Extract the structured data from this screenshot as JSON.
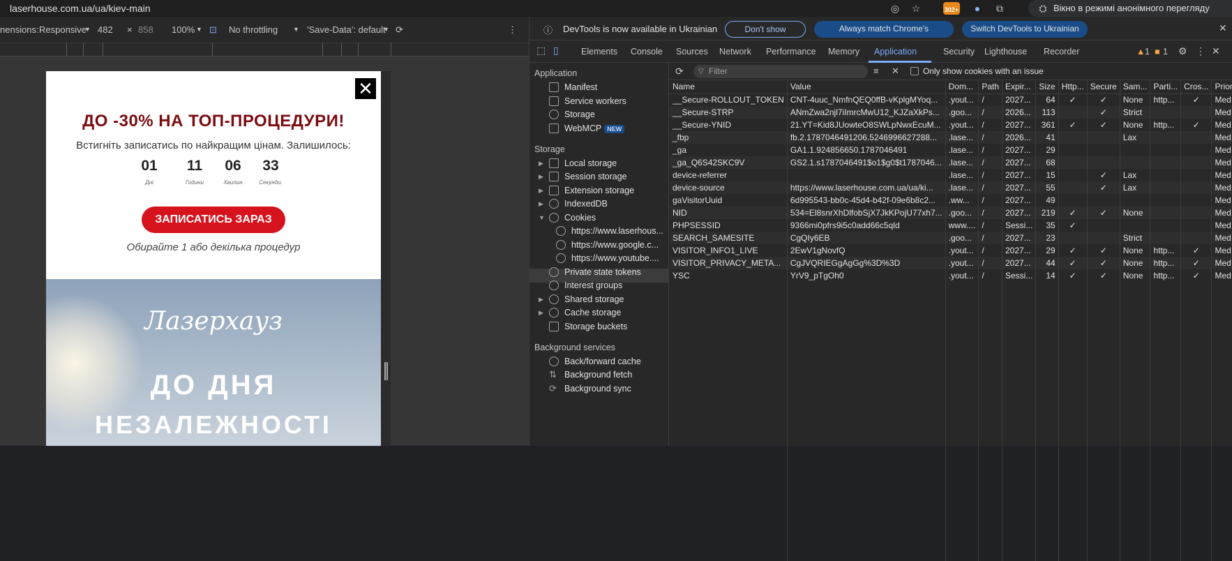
{
  "browser": {
    "url": "laserhouse.com.ua/ua/kiev-main",
    "extension_badge": "302+",
    "incognito_label": "Вікно в режимі анонімного перегляду"
  },
  "device_toolbar": {
    "dimensions_label": "nensions:",
    "mode": "Responsive",
    "width": "482",
    "times": "×",
    "height": "858",
    "zoom": "100%",
    "throttling": "No throttling",
    "save_data": "'Save-Data': default"
  },
  "popup": {
    "close_glyph": "✕",
    "headline": "ДО -30% НА ТОП-ПРОЦЕДУРИ!",
    "subtitle": "Встигніть записатись по найкращим цінам. Залишилось:",
    "countdown": [
      {
        "value": "01",
        "label": "Днi"
      },
      {
        "value": "11",
        "label": "Години"
      },
      {
        "value": "06",
        "label": "Хвилин"
      },
      {
        "value": "33",
        "label": "Секунди."
      }
    ],
    "cta_label": "ЗАПИСАТИСЬ ЗАРАЗ",
    "hint": "Обирайте 1 або декілька процедур"
  },
  "hero": {
    "logo": "Лазерхауз",
    "line1": "ДО ДНЯ",
    "line2": "НЕЗАЛЕЖНОСТІ"
  },
  "devtools": {
    "infobar": {
      "message": "DevTools is now available in Ukrainian",
      "dont_show": "Don't show again",
      "match_lang": "Always match Chrome's language",
      "switch_lang": "Switch DevTools to Ukrainian"
    },
    "tabs": [
      "Elements",
      "Console",
      "Sources",
      "Network",
      "Performance",
      "Memory",
      "Application",
      "Security",
      "Lighthouse",
      "Recorder"
    ],
    "active_tab": "Application",
    "warnings_count": "1",
    "issues_count": "1",
    "sidebar": {
      "application_header": "Application",
      "application_items": [
        "Manifest",
        "Service workers",
        "Storage",
        "WebMCP"
      ],
      "new_badge": "NEW",
      "storage_header": "Storage",
      "storage_items": [
        "Local storage",
        "Session storage",
        "Extension storage",
        "IndexedDB",
        "Cookies"
      ],
      "cookie_origins": [
        "https://www.laserhous...",
        "https://www.google.c...",
        "https://www.youtube...."
      ],
      "storage_items2": [
        "Private state tokens",
        "Interest groups",
        "Shared storage",
        "Cache storage",
        "Storage buckets"
      ],
      "background_header": "Background services",
      "background_items": [
        "Back/forward cache",
        "Background fetch",
        "Background sync"
      ]
    },
    "filter": {
      "placeholder": "Filter",
      "only_issue_label": "Only show cookies with an issue"
    },
    "cookie_columns": [
      "Name",
      "Value",
      "Dom...",
      "Path",
      "Expir...",
      "Size",
      "Http...",
      "Secure",
      "Sam...",
      "Parti...",
      "Cros...",
      "Prior..."
    ],
    "cookies": [
      [
        "__Secure-ROLLOUT_TOKEN",
        "CNT-4uuc_NmfnQEQ0ffB-vKplgMYoq...",
        ".yout...",
        "/",
        "2027...",
        "64",
        "✓",
        "✓",
        "None",
        "http...",
        "✓",
        "Med..."
      ],
      [
        "__Secure-STRP",
        "ANmZwa2njl7iImrcMwU12_KJZaXkPs...",
        ".goo...",
        "/",
        "2026...",
        "113",
        "",
        "✓",
        "Strict",
        "",
        "",
        "Med..."
      ],
      [
        "__Secure-YNID",
        "21.YT=Kid8JUowteO8SWLpNwxEcuM...",
        ".yout...",
        "/",
        "2027...",
        "361",
        "✓",
        "✓",
        "None",
        "http...",
        "✓",
        "Med..."
      ],
      [
        "_fbp",
        "fb.2.1787046491206.5246996627288...",
        ".lase...",
        "/",
        "2026...",
        "41",
        "",
        "",
        "Lax",
        "",
        "",
        "Med..."
      ],
      [
        "_ga",
        "GA1.1.924856650.1787046491",
        ".lase...",
        "/",
        "2027...",
        "29",
        "",
        "",
        "",
        "",
        "",
        "Med..."
      ],
      [
        "_ga_Q6S42SKC9V",
        "GS2.1.s1787046491$o1$g0$t1787046...",
        ".lase...",
        "/",
        "2027...",
        "68",
        "",
        "",
        "",
        "",
        "",
        "Med..."
      ],
      [
        "device-referrer",
        "",
        ".lase...",
        "/",
        "2027...",
        "15",
        "",
        "✓",
        "Lax",
        "",
        "",
        "Med..."
      ],
      [
        "device-source",
        "https://www.laserhouse.com.ua/ua/ki...",
        ".lase...",
        "/",
        "2027...",
        "55",
        "",
        "✓",
        "Lax",
        "",
        "",
        "Med..."
      ],
      [
        "gaVisitorUuid",
        "6d995543-bb0c-45d4-b42f-09e6b8c2...",
        ".ww...",
        "/",
        "2027...",
        "49",
        "",
        "",
        "",
        "",
        "",
        "Med..."
      ],
      [
        "NID",
        "534=El8snrXhDlfobSjX7JkKPojU77xh7...",
        ".goo...",
        "/",
        "2027...",
        "219",
        "✓",
        "✓",
        "None",
        "",
        "",
        "Med..."
      ],
      [
        "PHPSESSID",
        "9366mi0pfrs9i5c0add66c5qld",
        "www....",
        "/",
        "Sessi...",
        "35",
        "✓",
        "",
        "",
        "",
        "",
        "Med..."
      ],
      [
        "SEARCH_SAMESITE",
        "CgQIy6EB",
        ".goo...",
        "/",
        "2027...",
        "23",
        "",
        "",
        "Strict",
        "",
        "",
        "Med..."
      ],
      [
        "VISITOR_INFO1_LIVE",
        "2EwV1gNovfQ",
        ".yout...",
        "/",
        "2027...",
        "29",
        "✓",
        "✓",
        "None",
        "http...",
        "✓",
        "Med..."
      ],
      [
        "VISITOR_PRIVACY_META...",
        "CgJVQRIEGgAgGg%3D%3D",
        ".yout...",
        "/",
        "2027...",
        "44",
        "✓",
        "✓",
        "None",
        "http...",
        "✓",
        "Med..."
      ],
      [
        "YSC",
        "YrV9_pTgOh0",
        ".yout...",
        "/",
        "Sessi...",
        "14",
        "✓",
        "✓",
        "None",
        "http...",
        "✓",
        "Med..."
      ]
    ]
  }
}
